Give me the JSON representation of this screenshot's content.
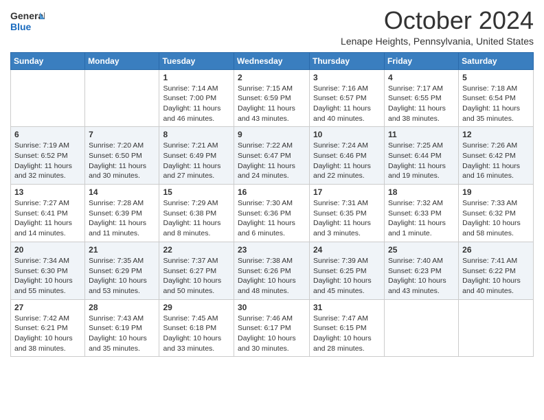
{
  "header": {
    "logo": {
      "line1": "General",
      "line2": "Blue"
    },
    "month_year": "October 2024",
    "location": "Lenape Heights, Pennsylvania, United States"
  },
  "days_of_week": [
    "Sunday",
    "Monday",
    "Tuesday",
    "Wednesday",
    "Thursday",
    "Friday",
    "Saturday"
  ],
  "weeks": [
    [
      {
        "day": "",
        "sunrise": "",
        "sunset": "",
        "daylight": ""
      },
      {
        "day": "",
        "sunrise": "",
        "sunset": "",
        "daylight": ""
      },
      {
        "day": "1",
        "sunrise": "Sunrise: 7:14 AM",
        "sunset": "Sunset: 7:00 PM",
        "daylight": "Daylight: 11 hours and 46 minutes."
      },
      {
        "day": "2",
        "sunrise": "Sunrise: 7:15 AM",
        "sunset": "Sunset: 6:59 PM",
        "daylight": "Daylight: 11 hours and 43 minutes."
      },
      {
        "day": "3",
        "sunrise": "Sunrise: 7:16 AM",
        "sunset": "Sunset: 6:57 PM",
        "daylight": "Daylight: 11 hours and 40 minutes."
      },
      {
        "day": "4",
        "sunrise": "Sunrise: 7:17 AM",
        "sunset": "Sunset: 6:55 PM",
        "daylight": "Daylight: 11 hours and 38 minutes."
      },
      {
        "day": "5",
        "sunrise": "Sunrise: 7:18 AM",
        "sunset": "Sunset: 6:54 PM",
        "daylight": "Daylight: 11 hours and 35 minutes."
      }
    ],
    [
      {
        "day": "6",
        "sunrise": "Sunrise: 7:19 AM",
        "sunset": "Sunset: 6:52 PM",
        "daylight": "Daylight: 11 hours and 32 minutes."
      },
      {
        "day": "7",
        "sunrise": "Sunrise: 7:20 AM",
        "sunset": "Sunset: 6:50 PM",
        "daylight": "Daylight: 11 hours and 30 minutes."
      },
      {
        "day": "8",
        "sunrise": "Sunrise: 7:21 AM",
        "sunset": "Sunset: 6:49 PM",
        "daylight": "Daylight: 11 hours and 27 minutes."
      },
      {
        "day": "9",
        "sunrise": "Sunrise: 7:22 AM",
        "sunset": "Sunset: 6:47 PM",
        "daylight": "Daylight: 11 hours and 24 minutes."
      },
      {
        "day": "10",
        "sunrise": "Sunrise: 7:24 AM",
        "sunset": "Sunset: 6:46 PM",
        "daylight": "Daylight: 11 hours and 22 minutes."
      },
      {
        "day": "11",
        "sunrise": "Sunrise: 7:25 AM",
        "sunset": "Sunset: 6:44 PM",
        "daylight": "Daylight: 11 hours and 19 minutes."
      },
      {
        "day": "12",
        "sunrise": "Sunrise: 7:26 AM",
        "sunset": "Sunset: 6:42 PM",
        "daylight": "Daylight: 11 hours and 16 minutes."
      }
    ],
    [
      {
        "day": "13",
        "sunrise": "Sunrise: 7:27 AM",
        "sunset": "Sunset: 6:41 PM",
        "daylight": "Daylight: 11 hours and 14 minutes."
      },
      {
        "day": "14",
        "sunrise": "Sunrise: 7:28 AM",
        "sunset": "Sunset: 6:39 PM",
        "daylight": "Daylight: 11 hours and 11 minutes."
      },
      {
        "day": "15",
        "sunrise": "Sunrise: 7:29 AM",
        "sunset": "Sunset: 6:38 PM",
        "daylight": "Daylight: 11 hours and 8 minutes."
      },
      {
        "day": "16",
        "sunrise": "Sunrise: 7:30 AM",
        "sunset": "Sunset: 6:36 PM",
        "daylight": "Daylight: 11 hours and 6 minutes."
      },
      {
        "day": "17",
        "sunrise": "Sunrise: 7:31 AM",
        "sunset": "Sunset: 6:35 PM",
        "daylight": "Daylight: 11 hours and 3 minutes."
      },
      {
        "day": "18",
        "sunrise": "Sunrise: 7:32 AM",
        "sunset": "Sunset: 6:33 PM",
        "daylight": "Daylight: 11 hours and 1 minute."
      },
      {
        "day": "19",
        "sunrise": "Sunrise: 7:33 AM",
        "sunset": "Sunset: 6:32 PM",
        "daylight": "Daylight: 10 hours and 58 minutes."
      }
    ],
    [
      {
        "day": "20",
        "sunrise": "Sunrise: 7:34 AM",
        "sunset": "Sunset: 6:30 PM",
        "daylight": "Daylight: 10 hours and 55 minutes."
      },
      {
        "day": "21",
        "sunrise": "Sunrise: 7:35 AM",
        "sunset": "Sunset: 6:29 PM",
        "daylight": "Daylight: 10 hours and 53 minutes."
      },
      {
        "day": "22",
        "sunrise": "Sunrise: 7:37 AM",
        "sunset": "Sunset: 6:27 PM",
        "daylight": "Daylight: 10 hours and 50 minutes."
      },
      {
        "day": "23",
        "sunrise": "Sunrise: 7:38 AM",
        "sunset": "Sunset: 6:26 PM",
        "daylight": "Daylight: 10 hours and 48 minutes."
      },
      {
        "day": "24",
        "sunrise": "Sunrise: 7:39 AM",
        "sunset": "Sunset: 6:25 PM",
        "daylight": "Daylight: 10 hours and 45 minutes."
      },
      {
        "day": "25",
        "sunrise": "Sunrise: 7:40 AM",
        "sunset": "Sunset: 6:23 PM",
        "daylight": "Daylight: 10 hours and 43 minutes."
      },
      {
        "day": "26",
        "sunrise": "Sunrise: 7:41 AM",
        "sunset": "Sunset: 6:22 PM",
        "daylight": "Daylight: 10 hours and 40 minutes."
      }
    ],
    [
      {
        "day": "27",
        "sunrise": "Sunrise: 7:42 AM",
        "sunset": "Sunset: 6:21 PM",
        "daylight": "Daylight: 10 hours and 38 minutes."
      },
      {
        "day": "28",
        "sunrise": "Sunrise: 7:43 AM",
        "sunset": "Sunset: 6:19 PM",
        "daylight": "Daylight: 10 hours and 35 minutes."
      },
      {
        "day": "29",
        "sunrise": "Sunrise: 7:45 AM",
        "sunset": "Sunset: 6:18 PM",
        "daylight": "Daylight: 10 hours and 33 minutes."
      },
      {
        "day": "30",
        "sunrise": "Sunrise: 7:46 AM",
        "sunset": "Sunset: 6:17 PM",
        "daylight": "Daylight: 10 hours and 30 minutes."
      },
      {
        "day": "31",
        "sunrise": "Sunrise: 7:47 AM",
        "sunset": "Sunset: 6:15 PM",
        "daylight": "Daylight: 10 hours and 28 minutes."
      },
      {
        "day": "",
        "sunrise": "",
        "sunset": "",
        "daylight": ""
      },
      {
        "day": "",
        "sunrise": "",
        "sunset": "",
        "daylight": ""
      }
    ]
  ]
}
